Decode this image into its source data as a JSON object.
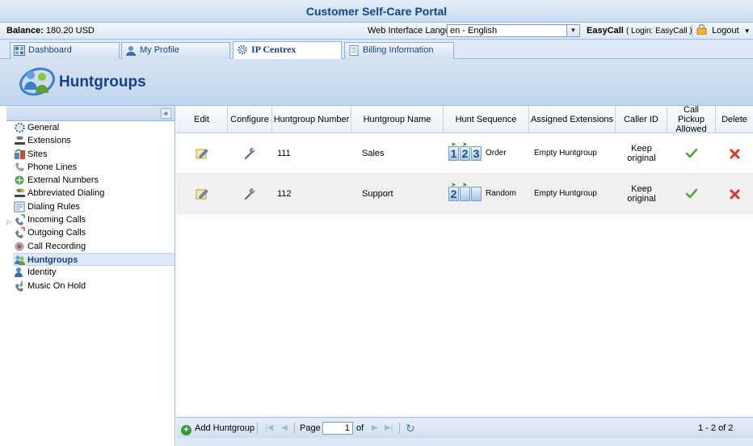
{
  "header": {
    "title": "Customer Self-Care Portal"
  },
  "info_bar": {
    "balance_label": "Balance:",
    "balance_value": "180.20 USD",
    "language_label": "Web Interface Language:",
    "language_value": "en - English",
    "user_name": "EasyCall",
    "login_text": "( Login: EasyCall )",
    "logout_label": "Logout"
  },
  "tabs": [
    {
      "label": "Dashboard",
      "active": false
    },
    {
      "label": "My Profile",
      "active": false
    },
    {
      "label": "IP Centrex",
      "active": true
    },
    {
      "label": "Billing Information",
      "active": false
    }
  ],
  "page": {
    "title": "Huntgroups"
  },
  "nav": {
    "collapse_label": "«",
    "items": [
      {
        "label": "General",
        "icon": "gear-icon"
      },
      {
        "label": "Extensions",
        "icon": "extensions-icon"
      },
      {
        "label": "Sites",
        "icon": "sites-icon"
      },
      {
        "label": "Phone Lines",
        "icon": "phone-lines-icon"
      },
      {
        "label": "External Numbers",
        "icon": "external-numbers-icon"
      },
      {
        "label": "Abbreviated Dialing",
        "icon": "abbreviated-dialing-icon"
      },
      {
        "label": "Dialing Rules",
        "icon": "dialing-rules-icon"
      },
      {
        "label": "Incoming Calls",
        "icon": "incoming-calls-icon"
      },
      {
        "label": "Outgoing Calls",
        "icon": "outgoing-calls-icon"
      },
      {
        "label": "Call Recording",
        "icon": "call-recording-icon"
      },
      {
        "label": "Huntgroups",
        "icon": "huntgroups-icon",
        "selected": true
      },
      {
        "label": "Identity",
        "icon": "identity-icon"
      },
      {
        "label": "Music On Hold",
        "icon": "music-on-hold-icon"
      }
    ]
  },
  "grid": {
    "columns": [
      "Edit",
      "Configure",
      "Huntgroup Number",
      "Huntgroup Name",
      "Hunt Sequence",
      "Assigned Extensions",
      "Caller ID",
      "Call Pickup Allowed",
      "Delete"
    ],
    "rows": [
      {
        "number": "111",
        "name": "Sales",
        "sequence": "Order",
        "assigned": "Empty Huntgroup",
        "caller_id": "Keep original"
      },
      {
        "number": "112",
        "name": "Support",
        "sequence": "Random",
        "assigned": "Empty Huntgroup",
        "caller_id": "Keep original"
      }
    ]
  },
  "toolbar": {
    "add_label": "Add Huntgroup",
    "page_label": "Page",
    "page_value": "1",
    "of_label": "of",
    "range_label": "1 - 2 of 2"
  },
  "colors": {
    "brand_blue": "#15428b",
    "header_bg": "#c9dbf0",
    "success_green": "#3c9a3c",
    "danger_red": "#d9362a"
  }
}
